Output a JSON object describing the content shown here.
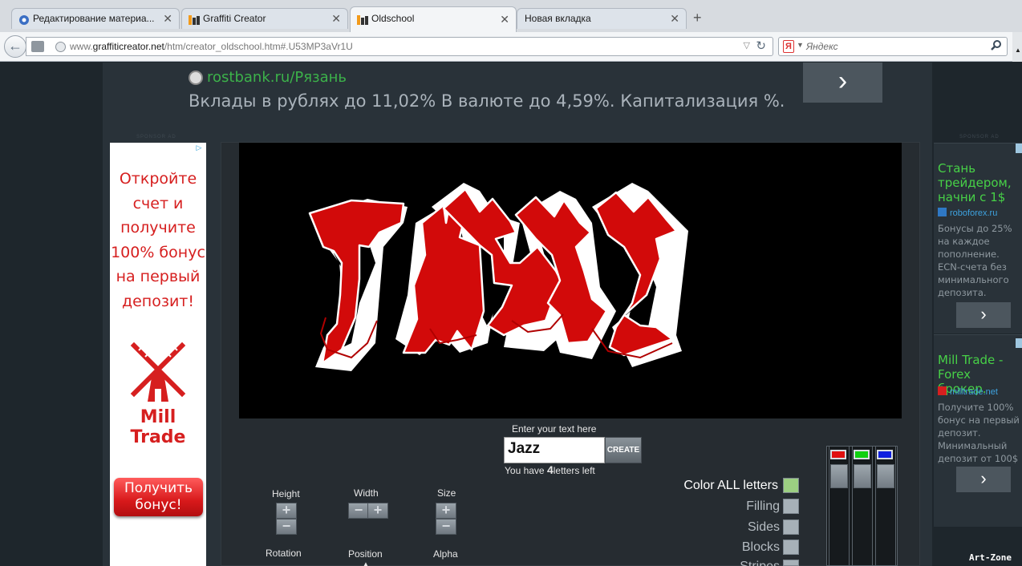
{
  "tabs": [
    {
      "label": "Редактирование материа...",
      "icon": "settings-favicon"
    },
    {
      "label": "Graffiti Creator",
      "icon": "graffiti-favicon"
    },
    {
      "label": "Oldschool",
      "icon": "graffiti-favicon",
      "active": true
    },
    {
      "label": "Новая вкладка",
      "icon": ""
    }
  ],
  "navbar": {
    "url_prefix": "www.",
    "url_domain": "graffiticreator.net",
    "url_path": "/htm/creator_oldschool.htm#.U53MP3aVr1U",
    "search_placeholder": "Яндекс",
    "search_engine_logo": "Я"
  },
  "top_ad": {
    "link": "rostbank.ru/Рязань",
    "text": "Вклады в рублях до 11,02% В валюте до 4,59%. Капитализация %.",
    "next": "›"
  },
  "sponsor_label": "SPONSOR  AD",
  "left_ad": {
    "copy_lines": [
      "Откройте",
      "счет и",
      "получите",
      "100% бонус",
      "на первый",
      "депозит!"
    ],
    "brand": "Mill Trade",
    "button_lines": [
      "Получить",
      "бонус!"
    ]
  },
  "graffiti": {
    "word": "JAZZ",
    "fill_color": "#d20a0a",
    "outline_color": "#ffffff",
    "shadow_color": "#000000"
  },
  "controls": {
    "height_label": "Height",
    "width_label": "Width",
    "size_label": "Size",
    "rotation_label": "Rotation",
    "position_label": "Position",
    "alpha_label": "Alpha",
    "text_label": "Enter your text here",
    "text_value": "Jazz",
    "create_label": "CREATE",
    "letters_prefix": "You have",
    "letters_count": "4",
    "letters_suffix": "letters left",
    "plus": "+",
    "minus": "−"
  },
  "color_options": [
    {
      "label": "Color ALL letters",
      "color": "#9ccf82"
    },
    {
      "label": "Filling",
      "color": "#a7b1b8"
    },
    {
      "label": "Sides",
      "color": "#a7b1b8"
    },
    {
      "label": "Blocks",
      "color": "#a7b1b8"
    },
    {
      "label": "Stripes",
      "color": "#a7b1b8"
    }
  ],
  "mixer_swatches": [
    "#e01010",
    "#10d010",
    "#1020e0"
  ],
  "right_ads": [
    {
      "title_lines": [
        "Стань",
        "трейдером,",
        "начни с 1$"
      ],
      "domain": "roboforex.ru",
      "body": "Бонусы до 25% на каждое пополнение. ECN-счета без минимального депозита.",
      "next": "›"
    },
    {
      "title_lines": [
        "Mill Trade -",
        "Forex брокер."
      ],
      "domain": "milltrade.net",
      "body": "Получите 100% бонус на первый депозит. Минимальный депозит от 100$",
      "next": "›"
    }
  ],
  "watermark": "Art-Zone"
}
